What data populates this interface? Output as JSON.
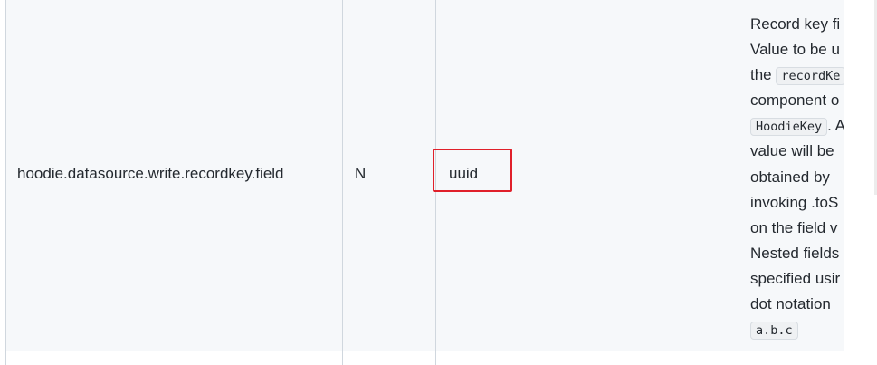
{
  "config_row": {
    "parameter": "hoodie.datasource.write.recordkey.field",
    "required": "N",
    "default": "uuid",
    "description_lines": [
      {
        "text": "Record key fi"
      },
      {
        "text": "Value to be u"
      },
      {
        "text_before": "the ",
        "code": "recordKe"
      },
      {
        "text": "component o"
      },
      {
        "code": "HoodieKey",
        "text_after": ". A"
      },
      {
        "text": "value will be"
      },
      {
        "text": "obtained by"
      },
      {
        "text": "invoking .toS"
      },
      {
        "text": "on the field v"
      },
      {
        "text": "Nested fields"
      },
      {
        "text": "specified usir"
      },
      {
        "text": "dot notation"
      },
      {
        "code": "a.b.c"
      }
    ]
  },
  "colors": {
    "row_background": "#f6f8fa",
    "border": "#d0d7de",
    "highlight_border": "#e0202a",
    "code_background": "#eff1f3"
  }
}
